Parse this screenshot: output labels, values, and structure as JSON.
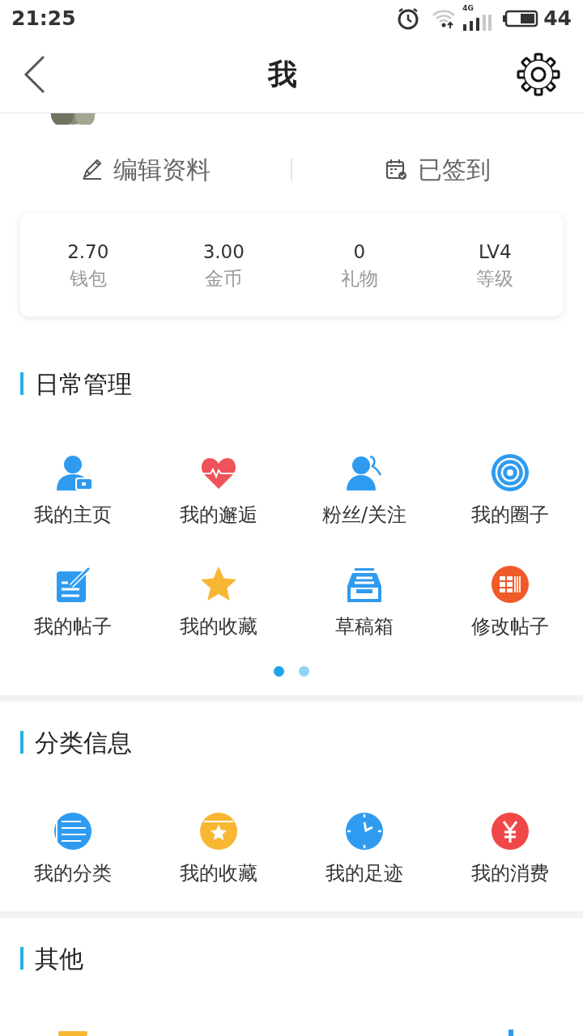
{
  "status_bar": {
    "time": "21:25",
    "network": "4G",
    "battery": "44"
  },
  "header": {
    "title": "我"
  },
  "actions": [
    {
      "label": "编辑资料"
    },
    {
      "label": "已签到"
    }
  ],
  "stats": [
    {
      "value": "2.70",
      "label": "钱包"
    },
    {
      "value": "3.00",
      "label": "金币"
    },
    {
      "value": "0",
      "label": "礼物"
    },
    {
      "value": "LV4",
      "label": "等级"
    }
  ],
  "sections": [
    {
      "title": "日常管理",
      "items": [
        {
          "label": "我的主页"
        },
        {
          "label": "我的邂逅"
        },
        {
          "label": "粉丝/关注"
        },
        {
          "label": "我的圈子"
        },
        {
          "label": "我的帖子"
        },
        {
          "label": "我的收藏"
        },
        {
          "label": "草稿箱"
        },
        {
          "label": "修改帖子"
        }
      ],
      "pager_dots": [
        {
          "selected": true
        },
        {
          "selected": false
        }
      ]
    },
    {
      "title": "分类信息",
      "items": [
        {
          "label": "我的分类"
        },
        {
          "label": "我的收藏"
        },
        {
          "label": "我的足迹"
        },
        {
          "label": "我的消费"
        }
      ]
    },
    {
      "title": "其他"
    }
  ]
}
